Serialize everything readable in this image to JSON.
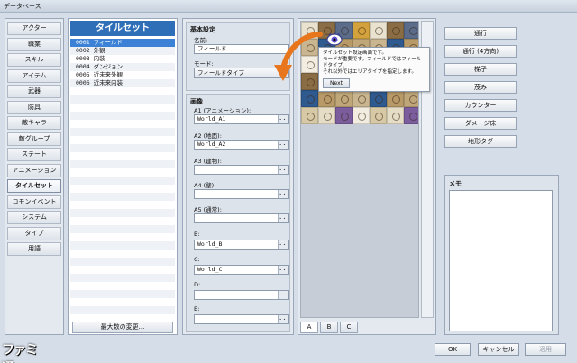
{
  "window": {
    "title": "データベース"
  },
  "categories": [
    {
      "label": "アクター"
    },
    {
      "label": "職業"
    },
    {
      "label": "スキル"
    },
    {
      "label": "アイテム"
    },
    {
      "label": "武器"
    },
    {
      "label": "防具"
    },
    {
      "label": "敵キャラ"
    },
    {
      "label": "敵グループ"
    },
    {
      "label": "ステート"
    },
    {
      "label": "アニメーション"
    },
    {
      "label": "タイルセット",
      "active": true
    },
    {
      "label": "コモンイベント"
    },
    {
      "label": "システム"
    },
    {
      "label": "タイプ"
    },
    {
      "label": "用語"
    }
  ],
  "tileset_list": {
    "header": "タイルセット",
    "items": [
      "0001 フィールド",
      "0002 外観",
      "0003 内装",
      "0004 ダンジョン",
      "0005 近未来外観",
      "0006 近未来内装"
    ],
    "selected_index": 0,
    "max_button": "最大数の変更..."
  },
  "basic": {
    "title": "基本設定",
    "name_label": "名前:",
    "name_value": "フィールド",
    "mode_label": "モード:",
    "mode_value": "フィールドタイプ"
  },
  "images": {
    "title": "画像",
    "slots": [
      {
        "label": "A1 (アニメーション):",
        "value": "World_A1"
      },
      {
        "label": "A2 (地面):",
        "value": "World_A2"
      },
      {
        "label": "A3 (建物):",
        "value": ""
      },
      {
        "label": "A4 (壁):",
        "value": ""
      },
      {
        "label": "A5 (通常):",
        "value": ""
      },
      {
        "label": "B:",
        "value": "World_B"
      },
      {
        "label": "C:",
        "value": "World_C"
      },
      {
        "label": "D:",
        "value": ""
      },
      {
        "label": "E:",
        "value": ""
      }
    ],
    "browse_label": "..."
  },
  "tooltip": {
    "lines": [
      "タイルセット設定画面です。",
      "モードが重要です。フィールドではフィールドタイプ、",
      "それ以外ではエリアタイプを指定します。"
    ],
    "next_label": "Next"
  },
  "tile_tabs": [
    {
      "label": "A",
      "active": true
    },
    {
      "label": "B"
    },
    {
      "label": "C"
    }
  ],
  "flag_buttons": [
    "通行",
    "通行 (4方向)",
    "梯子",
    "茂み",
    "カウンター",
    "ダメージ床",
    "地形タグ"
  ],
  "memo": {
    "title": "メモ",
    "value": ""
  },
  "footer": {
    "ok": "OK",
    "cancel": "キャンセル",
    "apply": "適用"
  },
  "watermark": "ファミ通.com",
  "colors": {
    "accent": "#2e6fb8",
    "selection": "#3b82d6",
    "arrow": "#e8761c"
  }
}
